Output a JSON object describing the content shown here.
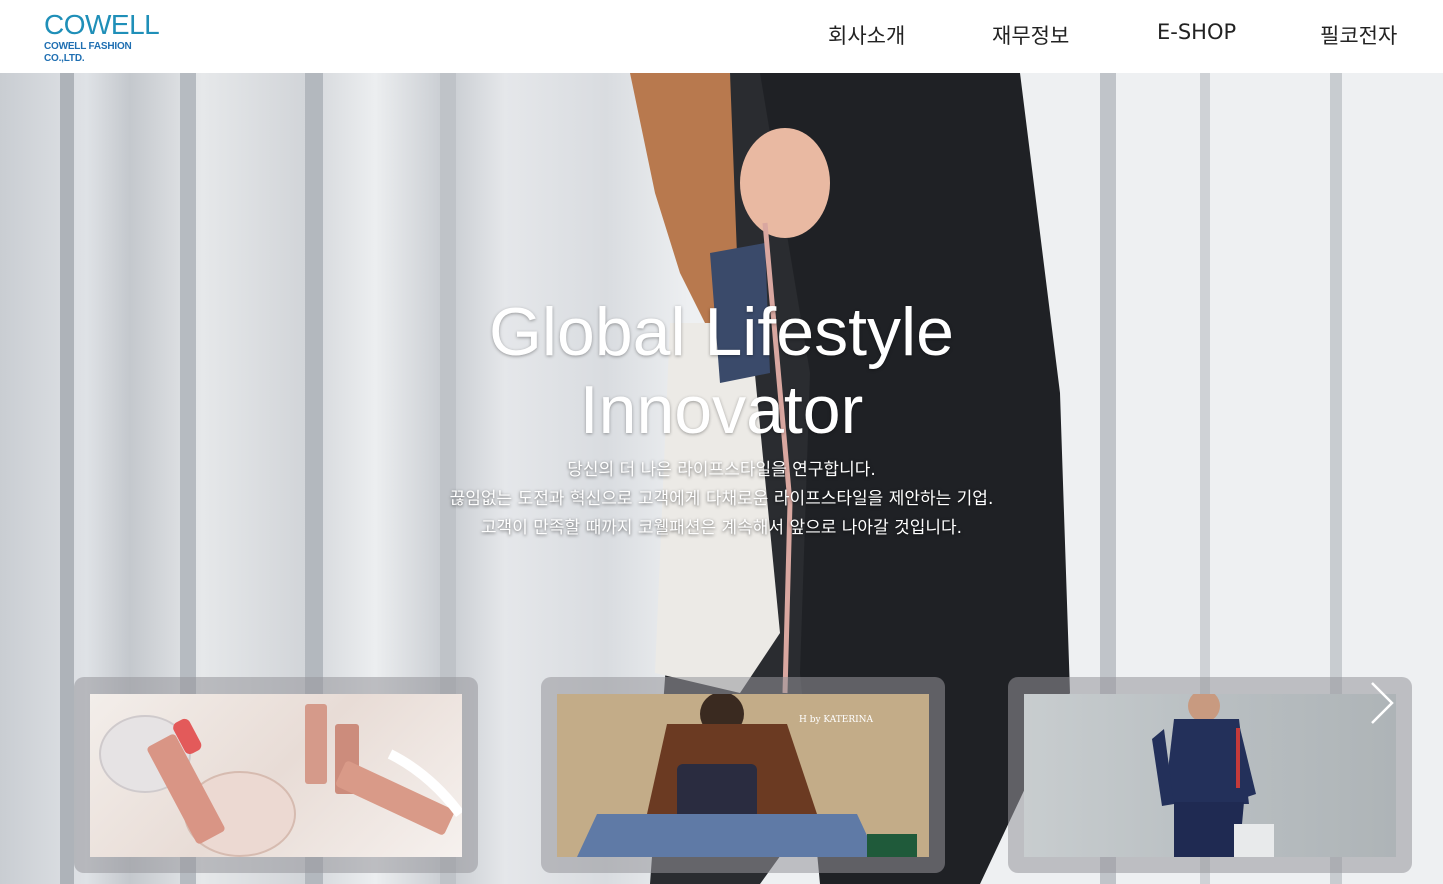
{
  "brand": {
    "logo_main": "COWELL",
    "logo_sub": "COWELL FASHION CO.,LTD.",
    "primary_color": "#1f8fb8",
    "accent_color": "#3fb6c7"
  },
  "nav": {
    "items": [
      {
        "label": "회사소개"
      },
      {
        "label": "재무정보"
      },
      {
        "label": "E-SHOP"
      },
      {
        "label": "필코전자"
      }
    ]
  },
  "hero": {
    "title_line1": "Global Lifestyle",
    "title_line2": "Innovator",
    "subtitle_lines": [
      "당신의 더 나은 라이프스타일을 연구합니다.",
      "끊임없는 도전과 혁신으로 고객에게 다채로운 라이프스타일을 제안하는 기업.",
      "고객이 만족할 때까지 코웰패션은 계속해서 앞으로 나아갈 것입니다."
    ]
  },
  "cards": [
    {
      "image": "cosmetics-lipstick-photo"
    },
    {
      "image": "fashion-bag-model-photo",
      "brand_text": "H by KATERINA"
    },
    {
      "image": "sportswear-model-photo"
    }
  ],
  "carousel": {
    "next_icon": "chevron-right-icon"
  }
}
